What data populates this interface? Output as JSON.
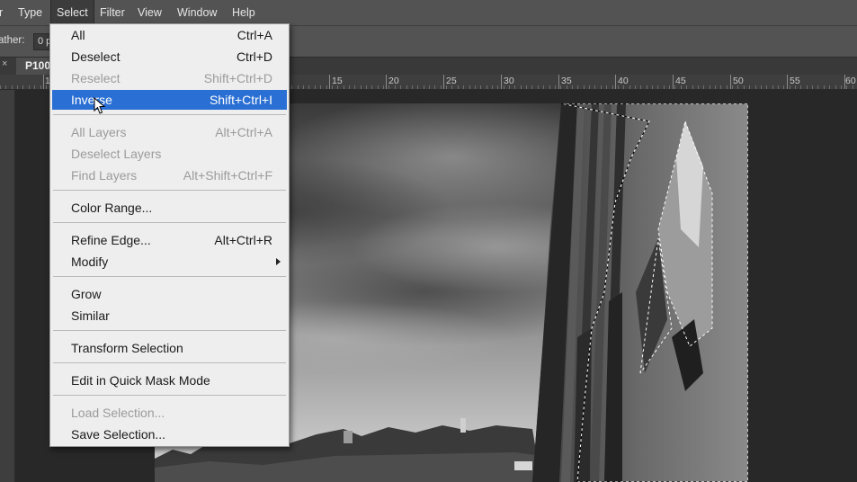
{
  "menubar": {
    "items": [
      {
        "label": "r",
        "active": false
      },
      {
        "label": "Type",
        "active": false
      },
      {
        "label": "Select",
        "active": true
      },
      {
        "label": "Filter",
        "active": false
      },
      {
        "label": "View",
        "active": false
      },
      {
        "label": "Window",
        "active": false
      },
      {
        "label": "Help",
        "active": false
      }
    ]
  },
  "options": {
    "feather_label": "ather:",
    "feather_value": "0 p"
  },
  "document_tab": {
    "close_icon": "×",
    "title": "P100"
  },
  "ruler": {
    "labels": [
      "1",
      "15",
      "20",
      "25",
      "30",
      "35",
      "40",
      "45",
      "50",
      "55",
      "60"
    ]
  },
  "select_menu": {
    "items": [
      {
        "label": "All",
        "shortcut": "Ctrl+A",
        "disabled": false
      },
      {
        "label": "Deselect",
        "shortcut": "Ctrl+D",
        "disabled": false
      },
      {
        "label": "Reselect",
        "shortcut": "Shift+Ctrl+D",
        "disabled": true
      },
      {
        "label": "Inverse",
        "shortcut": "Shift+Ctrl+I",
        "disabled": false,
        "highlighted": true
      },
      {
        "label": "All Layers",
        "shortcut": "Alt+Ctrl+A",
        "disabled": true
      },
      {
        "label": "Deselect Layers",
        "shortcut": "",
        "disabled": true
      },
      {
        "label": "Find Layers",
        "shortcut": "Alt+Shift+Ctrl+F",
        "disabled": true
      },
      {
        "label": "Color Range...",
        "shortcut": "",
        "disabled": false
      },
      {
        "label": "Refine Edge...",
        "shortcut": "Alt+Ctrl+R",
        "disabled": false
      },
      {
        "label": "Modify",
        "shortcut": "",
        "disabled": false,
        "submenu": true
      },
      {
        "label": "Grow",
        "shortcut": "",
        "disabled": false
      },
      {
        "label": "Similar",
        "shortcut": "",
        "disabled": false
      },
      {
        "label": "Transform Selection",
        "shortcut": "",
        "disabled": false
      },
      {
        "label": "Edit in Quick Mask Mode",
        "shortcut": "",
        "disabled": false
      },
      {
        "label": "Load Selection...",
        "shortcut": "",
        "disabled": true
      },
      {
        "label": "Save Selection...",
        "shortcut": "",
        "disabled": false
      }
    ]
  },
  "colors": {
    "menu_highlight": "#2a6fd3",
    "ui_panel": "#535353",
    "workspace": "#282828"
  }
}
